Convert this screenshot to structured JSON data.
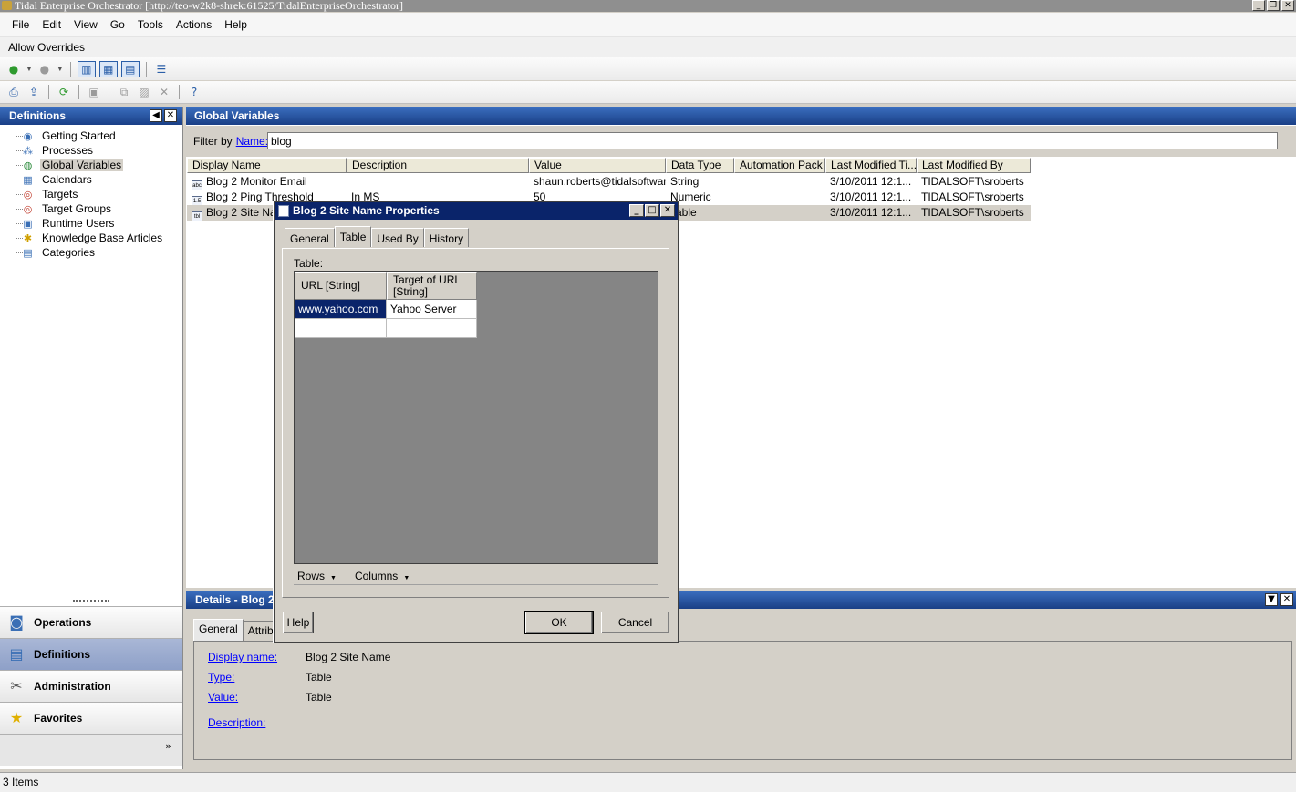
{
  "window": {
    "title": "Tidal Enterprise Orchestrator [http://teo-w2k8-shrek:61525/TidalEnterpriseOrchestrator]"
  },
  "menu": [
    "File",
    "Edit",
    "View",
    "Go",
    "Tools",
    "Actions",
    "Help"
  ],
  "overrides_label": "Allow Overrides",
  "nav": {
    "title": "Definitions",
    "tree": [
      {
        "label": "Getting Started",
        "icon": "getting-started-icon"
      },
      {
        "label": "Processes",
        "icon": "processes-icon"
      },
      {
        "label": "Global Variables",
        "icon": "globe-icon",
        "selected": true
      },
      {
        "label": "Calendars",
        "icon": "calendar-icon"
      },
      {
        "label": "Targets",
        "icon": "target-icon"
      },
      {
        "label": "Target Groups",
        "icon": "target-groups-icon"
      },
      {
        "label": "Runtime Users",
        "icon": "runtime-users-icon"
      },
      {
        "label": "Knowledge Base Articles",
        "icon": "lightbulb-icon"
      },
      {
        "label": "Categories",
        "icon": "categories-icon"
      }
    ],
    "buttons": [
      {
        "label": "Operations",
        "icon": "operations-icon"
      },
      {
        "label": "Definitions",
        "icon": "definitions-icon",
        "selected": true
      },
      {
        "label": "Administration",
        "icon": "tools-icon"
      },
      {
        "label": "Favorites",
        "icon": "star-icon"
      }
    ]
  },
  "main": {
    "title": "Global Variables",
    "filter": {
      "prefix": "Filter by",
      "link": "Name:",
      "value": "blog"
    },
    "columns": [
      "Display Name",
      "Description",
      "Value",
      "Data Type",
      "Automation Pack",
      "Last Modified Ti...",
      "Last Modified By"
    ],
    "rows": [
      {
        "icon": "abc",
        "name": "Blog 2 Monitor Email",
        "description": "",
        "value": "shaun.roberts@tidalsoftwar...",
        "type": "String",
        "pack": "",
        "modified": "3/10/2011 12:1...",
        "by": "TIDALSOFT\\sroberts"
      },
      {
        "icon": "1.5",
        "name": "Blog 2 Ping Threshold",
        "description": "In MS",
        "value": "50",
        "type": "Numeric",
        "pack": "",
        "modified": "3/10/2011 12:1...",
        "by": "TIDALSOFT\\sroberts"
      },
      {
        "icon": "tbl",
        "name": "Blog 2 Site Name",
        "description": "",
        "value": "",
        "type": "Table",
        "pack": "",
        "modified": "3/10/2011 12:1...",
        "by": "TIDALSOFT\\sroberts",
        "selected": true
      }
    ]
  },
  "details": {
    "title": "Details - Blog 2 Site Name",
    "tabs": [
      "General",
      "Attributes"
    ],
    "fields": [
      {
        "label": "Display name:",
        "value": "Blog 2 Site Name"
      },
      {
        "label": "Type:",
        "value": "Table"
      },
      {
        "label": "Value:",
        "value": "Table"
      },
      {
        "label": "Description:",
        "value": ""
      }
    ]
  },
  "dialog": {
    "title": "Blog 2 Site Name Properties",
    "tabs": [
      "General",
      "Table",
      "Used By",
      "History"
    ],
    "active_tab": "Table",
    "table_label": "Table:",
    "columns": [
      "URL [String]",
      "Target of URL [String]"
    ],
    "rows": [
      [
        "www.yahoo.com",
        "Yahoo Server"
      ],
      [
        "",
        ""
      ]
    ],
    "rows_menu": "Rows",
    "columns_menu": "Columns",
    "help": "Help",
    "ok": "OK",
    "cancel": "Cancel"
  },
  "status": "3 Items"
}
